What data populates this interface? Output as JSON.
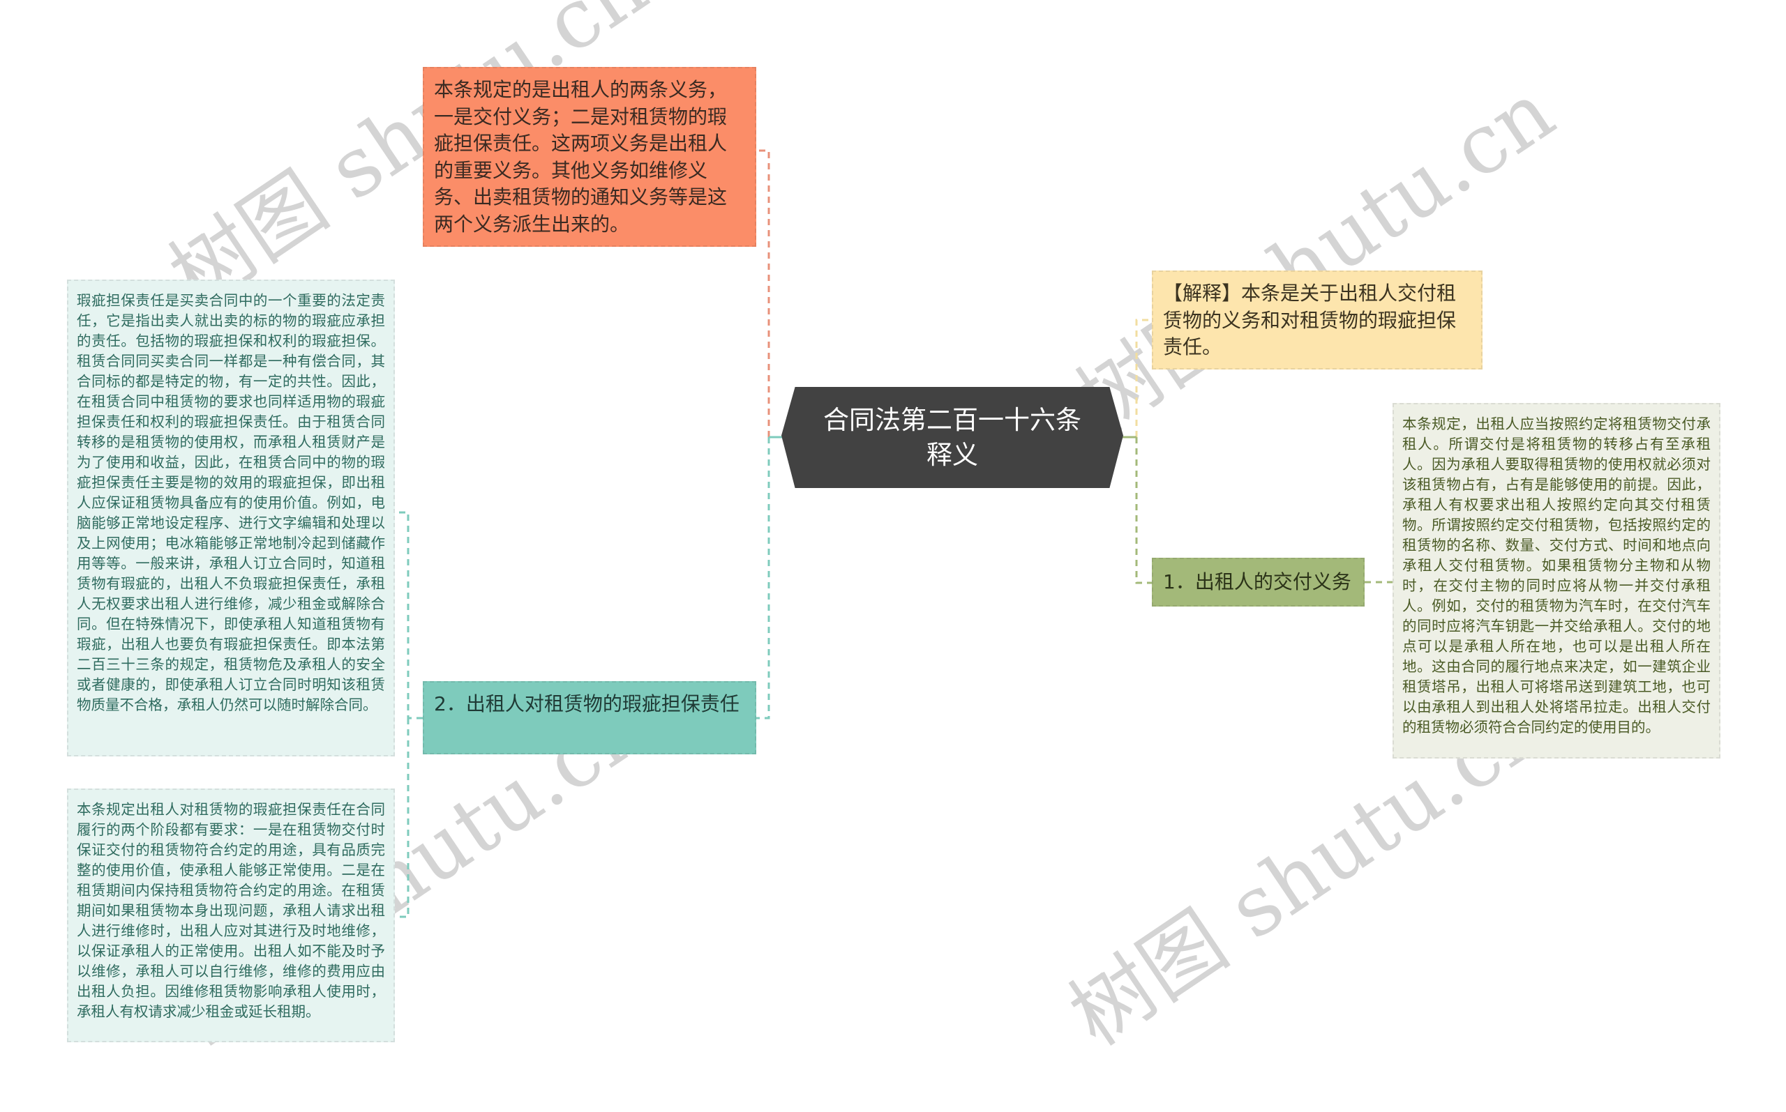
{
  "root": {
    "title": "合同法第二百一十六条释义"
  },
  "left_branches": [
    {
      "label": "本条规定的是出租人的两条义务，一是交付义务；二是对租赁物的瑕疵担保责任。这两项义务是出租人的重要义务。其他义务如维修义务、出卖租赁物的通知义务等是这两个义务派生出来的。",
      "color": "#fb8d68",
      "children": []
    },
    {
      "label": "2．出租人对租赁物的瑕疵担保责任",
      "color": "#7ecbbc",
      "children": [
        {
          "label": "瑕疵担保责任是买卖合同中的一个重要的法定责任，它是指出卖人就出卖的标的物的瑕疵应承担的责任。包括物的瑕疵担保和权利的瑕疵担保。租赁合同同买卖合同一样都是一种有偿合同，其合同标的都是特定的物，有一定的共性。因此，在租赁合同中租赁物的要求也同样适用物的瑕疵担保责任和权利的瑕疵担保责任。由于租赁合同转移的是租赁物的使用权，而承租人租赁财产是为了使用和收益，因此，在租赁合同中的物的瑕疵担保责任主要是物的效用的瑕疵担保，即出租人应保证租赁物具备应有的使用价值。例如，电脑能够正常地设定程序、进行文字编辑和处理以及上网使用；电冰箱能够正常地制冷起到储藏作用等等。一般来讲，承租人订立合同时，知道租赁物有瑕疵的，出租人不负瑕疵担保责任，承租人无权要求出租人进行维修，减少租金或解除合同。但在特殊情况下，即使承租人知道租赁物有瑕疵，出租人也要负有瑕疵担保责任。即本法第二百三十三条的规定，租赁物危及承租人的安全或者健康的，即使承租人订立合同时明知该租赁物质量不合格，承租人仍然可以随时解除合同。"
        },
        {
          "label": "本条规定出租人对租赁物的瑕疵担保责任在合同履行的两个阶段都有要求：一是在租赁物交付时保证交付的租赁物符合约定的用途，具有品质完整的使用价值，使承租人能够正常使用。二是在租赁期间内保持租赁物符合约定的用途。在租赁期间如果租赁物本身出现问题，承租人请求出租人进行维修时，出租人应对其进行及时地维修，以保证承租人的正常使用。出租人如不能及时予以维修，承租人可以自行维修，维修的费用应由出租人负担。因维修租赁物影响承租人使用时，承租人有权请求减少租金或延长租期。"
        }
      ]
    }
  ],
  "right_branches": [
    {
      "label": "【解释】本条是关于出租人交付租赁物的义务和对租赁物的瑕疵担保责任。",
      "color": "#fde5ad",
      "children": []
    },
    {
      "label": "1．出租人的交付义务",
      "color": "#a3b979",
      "children": [
        {
          "label": "本条规定，出租人应当按照约定将租赁物交付承租人。所谓交付是将租赁物的转移占有至承租人。因为承租人要取得租赁物的使用权就必须对该租赁物占有，占有是能够使用的前提。因此，承租人有权要求出租人按照约定向其交付租赁物。所谓按照约定交付租赁物，包括按照约定的租赁物的名称、数量、交付方式、时间和地点向承租人交付租赁物。如果租赁物分主物和从物时，在交付主物的同时应将从物一并交付承租人。例如，交付的租赁物为汽车时，在交付汽车的同时应将汽车钥匙一并交给承租人。交付的地点可以是承租人所在地，也可以是出租人所在地。这由合同的履行地点来决定，如一建筑企业租赁塔吊，出租人可将塔吊送到建筑工地，也可以由承租人到出租人处将塔吊拉走。出租人交付的租赁物必须符合合同约定的使用目的。"
        }
      ]
    }
  ],
  "watermark": {
    "text": "树图 shutu.cn"
  },
  "colors": {
    "root_bg": "#424242",
    "left_leaf_bg": "#e6f4f1",
    "right_leaf_bg": "#eef0e6",
    "orange_line": "#e8917a",
    "teal_line": "#7ecbbc",
    "yellow_line": "#f2dea0",
    "green_line": "#a3b979"
  }
}
